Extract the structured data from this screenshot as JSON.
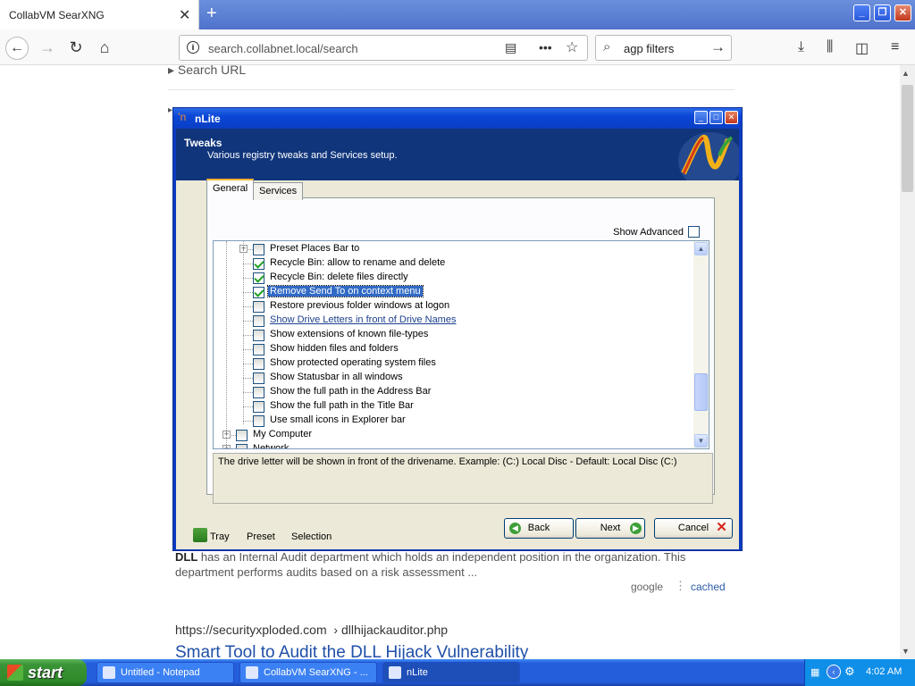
{
  "browser": {
    "tab_title": "CollabVM SearXNG",
    "tab_close": "✕",
    "new_tab": "+",
    "url": "search.collabnet.local/search",
    "search_text": "agp filters"
  },
  "page": {
    "search_url": "Search URL",
    "result": {
      "text_bold": "DLL",
      "text": " has an Internal Audit department which holds an independent position in the organization. This department performs audits based on a risk assessment ...",
      "engine": "google",
      "cached": "cached",
      "url": "https://securityxploded.com",
      "url_path": "› dllhijackauditor.php",
      "title": "Smart Tool to Audit the DLL Hijack Vulnerability"
    }
  },
  "nlite": {
    "title": "nLite",
    "header_title": "Tweaks",
    "header_subtitle": "Various registry tweaks and Services setup.",
    "tabs": [
      "General",
      "Services"
    ],
    "show_advanced": "Show Advanced",
    "tree_items": [
      {
        "label": "Preset Places Bar to",
        "checked": false
      },
      {
        "label": "Recycle Bin: allow to rename and delete",
        "checked": true
      },
      {
        "label": "Recycle Bin: delete files directly",
        "checked": true
      },
      {
        "label": "Remove Send To on context menu",
        "checked": true
      },
      {
        "label": "Restore previous folder windows at logon",
        "checked": false
      },
      {
        "label": "Show Drive Letters in front of Drive Names",
        "checked": false
      },
      {
        "label": "Show extensions of known file-types",
        "checked": false
      },
      {
        "label": "Show hidden files and folders",
        "checked": false
      },
      {
        "label": "Show protected operating system files",
        "checked": false
      },
      {
        "label": "Show Statusbar in all windows",
        "checked": false
      },
      {
        "label": "Show the full path in the Address Bar",
        "checked": false
      },
      {
        "label": "Show the full path in the Title Bar",
        "checked": false
      },
      {
        "label": "Use small icons in Explorer bar",
        "checked": false
      },
      {
        "label": "My Computer",
        "checked": false
      },
      {
        "label": "Network",
        "checked": false
      }
    ],
    "description": "The drive letter will be shown in front of the drivename. Example: (C:) Local Disc -  Default: Local Disc (C:)",
    "bottom": {
      "tray": "Tray",
      "preset": "Preset",
      "selection": "Selection"
    },
    "buttons": {
      "back": "Back",
      "next": "Next",
      "cancel": "Cancel"
    }
  },
  "taskbar": {
    "start": "start",
    "tasks": [
      "Untitled - Notepad",
      "CollabVM SearXNG - ...",
      "nLite"
    ],
    "clock": "4:02 AM"
  }
}
